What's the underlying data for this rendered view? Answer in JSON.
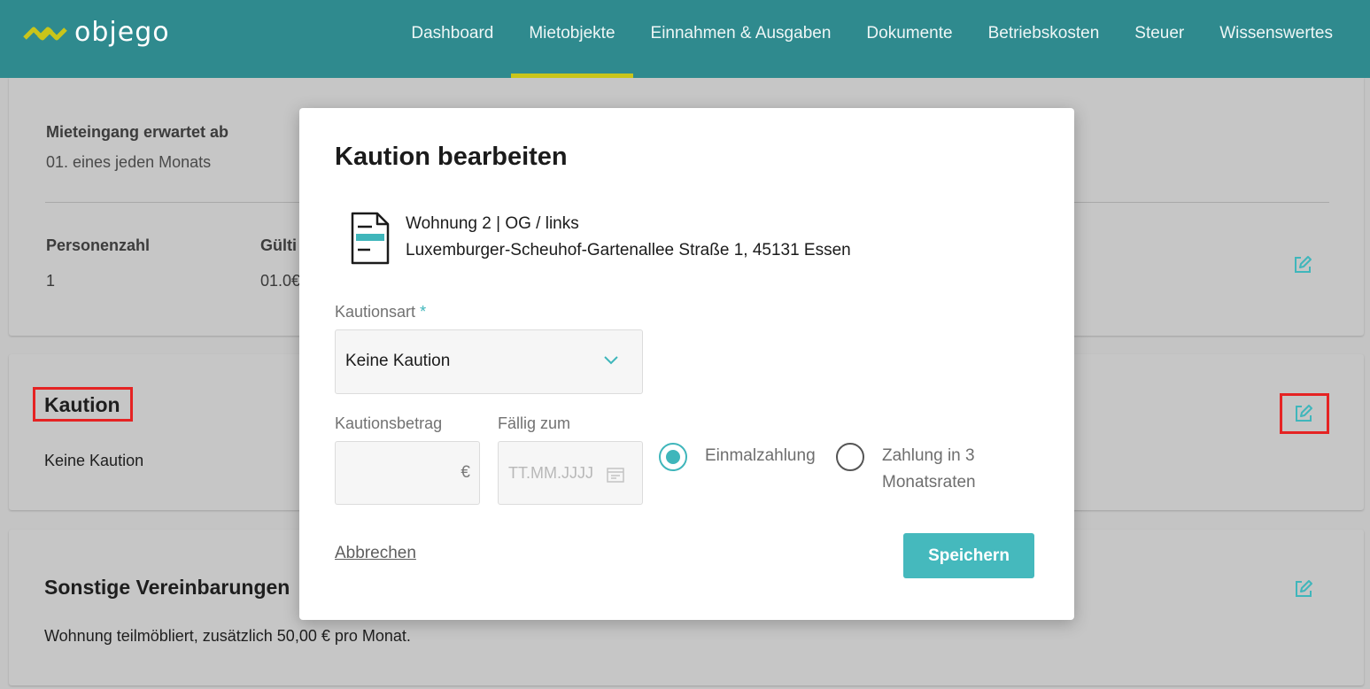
{
  "brand": {
    "name": "objego",
    "accent": "#2f8a8e",
    "active_underline": "#c9c51a"
  },
  "nav": {
    "items": [
      {
        "label": "Dashboard"
      },
      {
        "label": "Mietobjekte",
        "active": true
      },
      {
        "label": "Einnahmen & Ausgaben"
      },
      {
        "label": "Dokumente"
      },
      {
        "label": "Betriebskosten"
      },
      {
        "label": "Steuer"
      },
      {
        "label": "Wissenswertes"
      }
    ]
  },
  "rent_card": {
    "rent_due_label": "Mieteingang erwartet ab",
    "rent_due_value": "01. eines jeden Monats",
    "persons_label": "Personenzahl",
    "persons_value": "1",
    "valid_label_partial": "Gülti",
    "valid_value_partial": "01.0€"
  },
  "deposit_card": {
    "title": "Kaution",
    "value": "Keine Kaution"
  },
  "other_card": {
    "title": "Sonstige Vereinbarungen",
    "value": "Wohnung teilmöbliert, zusätzlich 50,00 € pro Monat."
  },
  "modal": {
    "title": "Kaution bearbeiten",
    "property_name": "Wohnung 2 | OG / links",
    "property_address": "Luxemburger-Scheuhof-Gartenallee Straße 1, 45131 Essen",
    "deposit_type_label": "Kautionsart",
    "required_marker": "*",
    "deposit_type_value": "Keine Kaution",
    "amount_label": "Kautionsbetrag",
    "amount_value": "",
    "currency": "€",
    "due_label": "Fällig zum",
    "due_placeholder": "TT.MM.JJJJ",
    "payment_options": [
      {
        "label": "Einmalzahlung",
        "checked": true
      },
      {
        "label_line1": "Zahlung in 3",
        "label_line2": "Monatsraten",
        "checked": false
      }
    ],
    "cancel_label": "Abbrechen",
    "save_label": "Speichern"
  }
}
